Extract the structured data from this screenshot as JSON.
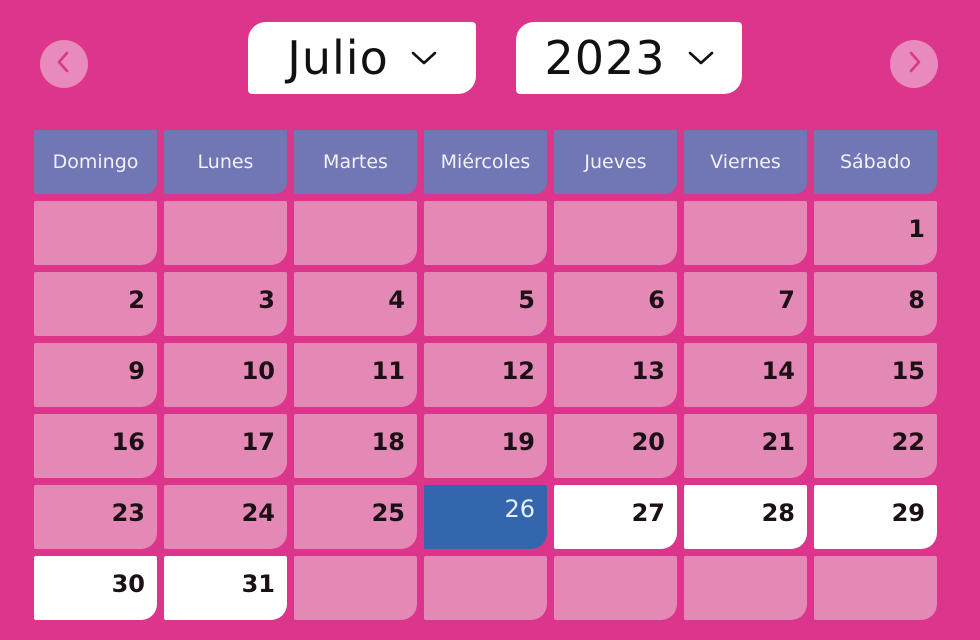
{
  "navigation": {
    "prev_icon": "chevron-left-icon",
    "next_icon": "chevron-right-icon"
  },
  "month_select": {
    "value": "Julio",
    "icon": "chevron-down-icon"
  },
  "year_select": {
    "value": "2023",
    "icon": "chevron-down-icon"
  },
  "weekdays": [
    "Domingo",
    "Lunes",
    "Martes",
    "Miércoles",
    "Jueves",
    "Viernes",
    "Sábado"
  ],
  "days": [
    "",
    "",
    "",
    "",
    "",
    "",
    "1",
    "2",
    "3",
    "4",
    "5",
    "6",
    "7",
    "8",
    "9",
    "10",
    "11",
    "12",
    "13",
    "14",
    "15",
    "16",
    "17",
    "18",
    "19",
    "20",
    "21",
    "22",
    "23",
    "24",
    "25",
    "26",
    "27",
    "28",
    "29",
    "30",
    "31",
    "",
    "",
    "",
    "",
    ""
  ],
  "selected_day": "26",
  "available_days": [
    "27",
    "28",
    "29",
    "30",
    "31"
  ],
  "colors": {
    "background": "#dc368c",
    "header": "#7176b4",
    "day_cell": "#e489b5",
    "available": "#ffffff",
    "selected": "#3466ad"
  }
}
